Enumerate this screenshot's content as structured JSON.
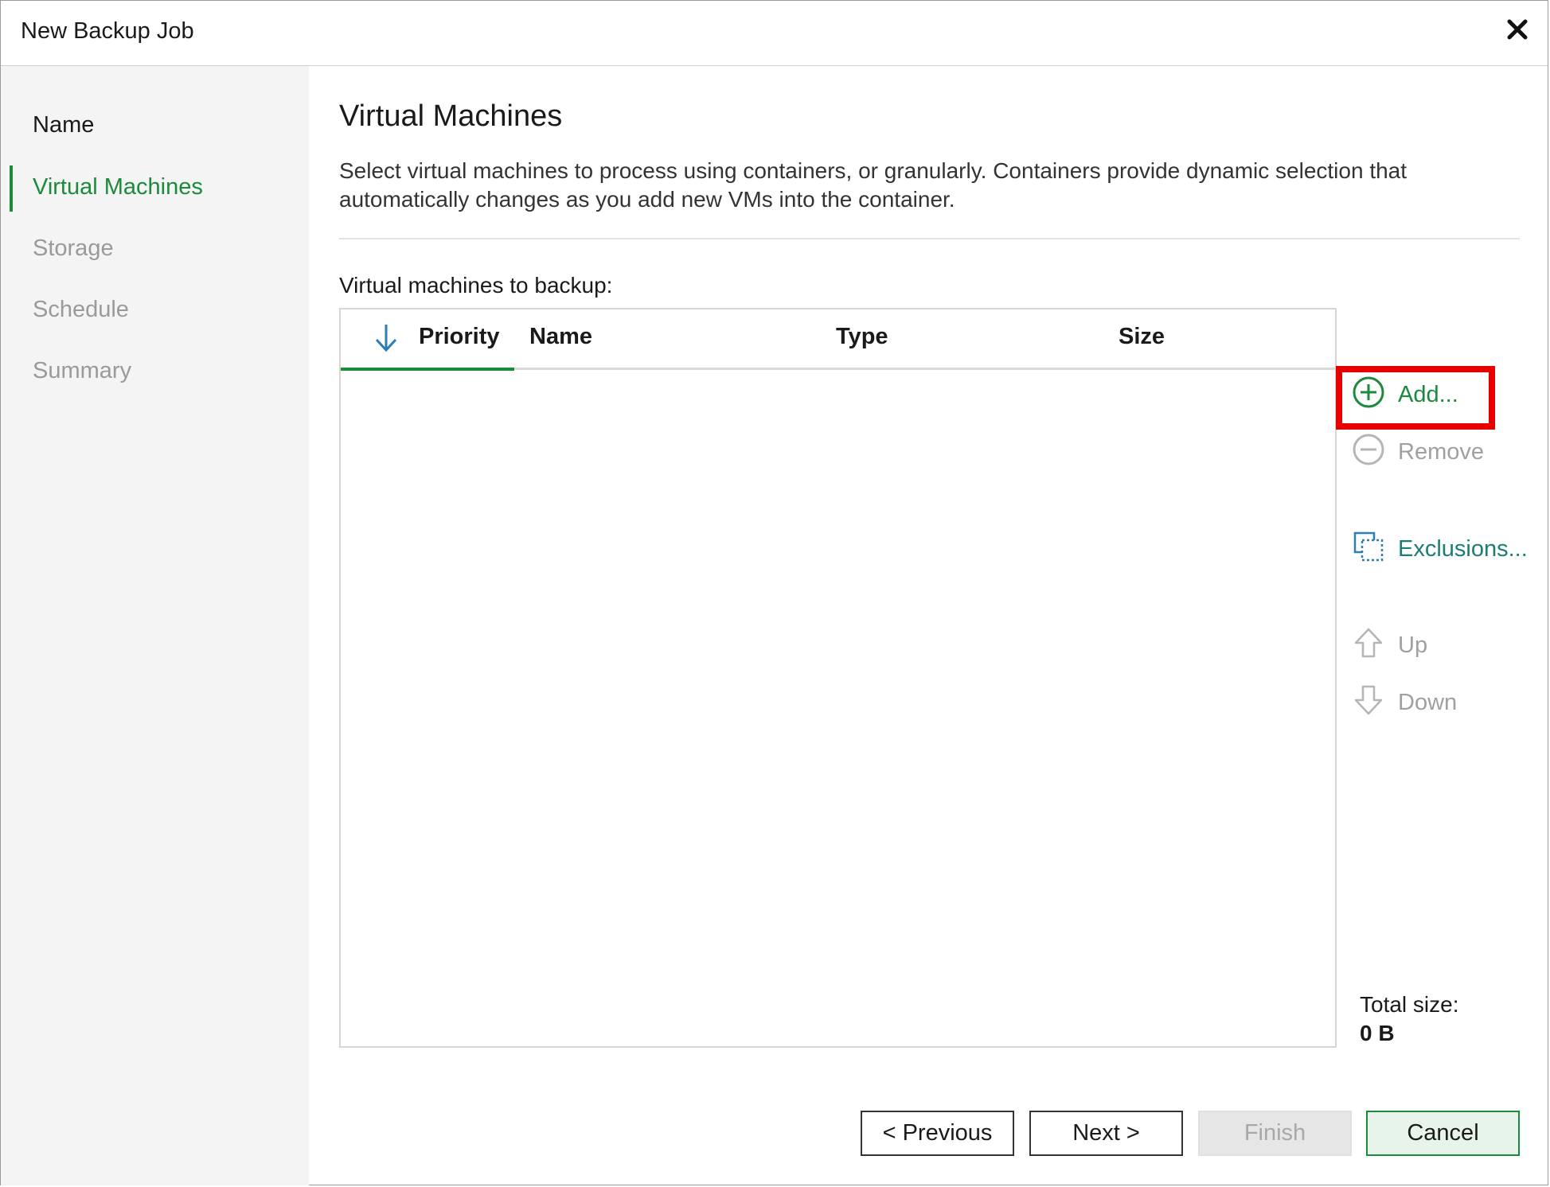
{
  "window": {
    "title": "New Backup Job"
  },
  "sidebar": {
    "items": [
      {
        "label": "Name",
        "state": "done"
      },
      {
        "label": "Virtual Machines",
        "state": "active"
      },
      {
        "label": "Storage",
        "state": "pending"
      },
      {
        "label": "Schedule",
        "state": "pending"
      },
      {
        "label": "Summary",
        "state": "pending"
      }
    ]
  },
  "main": {
    "title": "Virtual Machines",
    "description": "Select virtual machines to process using containers, or granularly. Containers provide dynamic selection that automatically changes as you add new VMs into the container.",
    "list_label": "Virtual machines to backup:",
    "table": {
      "columns": [
        "Priority",
        "Name",
        "Type",
        "Size"
      ],
      "sorted_column": "Priority",
      "rows": []
    },
    "actions": {
      "add": "Add...",
      "remove": "Remove",
      "exclusions": "Exclusions...",
      "up": "Up",
      "down": "Down"
    },
    "total_size_label": "Total size:",
    "total_size_value": "0 B"
  },
  "footer": {
    "previous": "< Previous",
    "next": "Next >",
    "finish": "Finish",
    "cancel": "Cancel"
  },
  "colors": {
    "accent_green": "#1c8a3c",
    "highlight_red": "#e80000",
    "disabled_gray": "#a0a0a0"
  }
}
